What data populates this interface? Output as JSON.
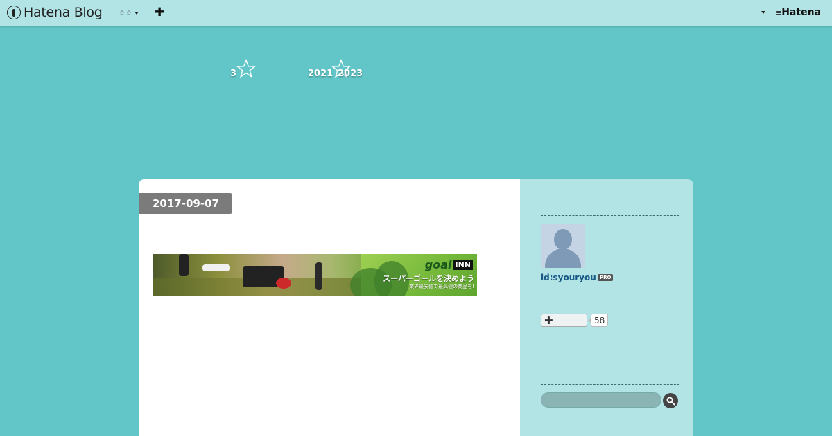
{
  "topbar": {
    "brand_name": "Hatena Blog",
    "stars_menu": "☆☆",
    "plus_icon": "✚",
    "hatena_text": "Hatena"
  },
  "header": {
    "count": "3",
    "year_a": "2021",
    "year_b": "2023"
  },
  "entry": {
    "date": "2017-09-07",
    "banner": {
      "brand": "goal",
      "brand_suffix": "INN",
      "tagline": "スーパーゴールを決めよう",
      "subtagline": "業界最安値で最高値の商品を!"
    }
  },
  "sidebar": {
    "user_id": "id:syouryou",
    "pro_label": "PRO",
    "follow_icon": "✚",
    "follower_count": "58"
  },
  "colors": {
    "background": "#62c6c8",
    "topbar": "#b2e3e5",
    "sidebar": "#b2e3e5",
    "date_badge": "#7b7b7b"
  }
}
